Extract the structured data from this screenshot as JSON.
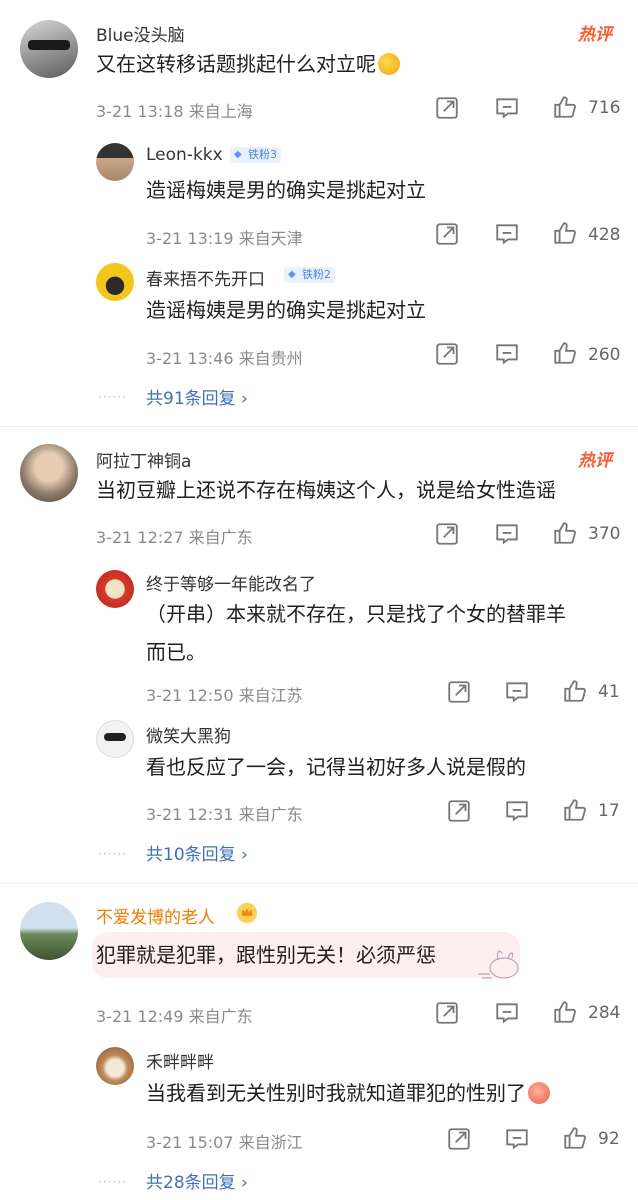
{
  "hot_label": "热评",
  "comments": [
    {
      "name": "Blue没头脑",
      "text": "又在这转移话题挑起什么对立呢",
      "meta": "3-21 13:18 来自上海",
      "likes": "716",
      "replies": [
        {
          "name": "Leon-kkx",
          "badge": "铁粉3",
          "text": "造谣梅姨是男的确实是挑起对立",
          "meta": "3-21 13:19 来自天津",
          "likes": "428"
        },
        {
          "name": "春来捂不先开口",
          "badge": "铁粉2",
          "text": "造谣梅姨是男的确实是挑起对立",
          "meta": "3-21 13:46 来自贵州",
          "likes": "260"
        }
      ],
      "more": "共91条回复 ›"
    },
    {
      "name": "阿拉丁神铜a",
      "text": "当初豆瓣上还说不存在梅姨这个人，说是给女性造谣",
      "meta": "3-21 12:27 来自广东",
      "likes": "370",
      "replies": [
        {
          "name": "终于等够一年能改名了",
          "text_line1": "（开串）本来就不存在，只是找了个女的替罪羊",
          "text_line2": "而已。",
          "meta": "3-21 12:50 来自江苏",
          "likes": "41"
        },
        {
          "name": "微笑大黑狗",
          "text": "看也反应了一会，记得当初好多人说是假的",
          "meta": "3-21 12:31 来自广东",
          "likes": "17"
        }
      ],
      "more": "共10条回复 ›"
    },
    {
      "name": "不爱发博的老人",
      "text": "犯罪就是犯罪，跟性别无关！必须严惩",
      "meta": "3-21 12:49 来自广东",
      "likes": "284",
      "replies": [
        {
          "name": "禾畔畔畔",
          "text": "当我看到无关性别时我就知道罪犯的性别了",
          "meta": "3-21 15:07 来自浙江",
          "likes": "92"
        }
      ],
      "more": "共28条回复 ›"
    }
  ],
  "reply_dots": "······",
  "icons": [
    "share-icon",
    "comment-icon",
    "like-icon",
    "crown-badge-icon"
  ],
  "colors": {
    "link": "#3d72b8",
    "vip_name": "#f07c00",
    "hot": "#ff5a36",
    "meta": "#8a8a8a"
  }
}
